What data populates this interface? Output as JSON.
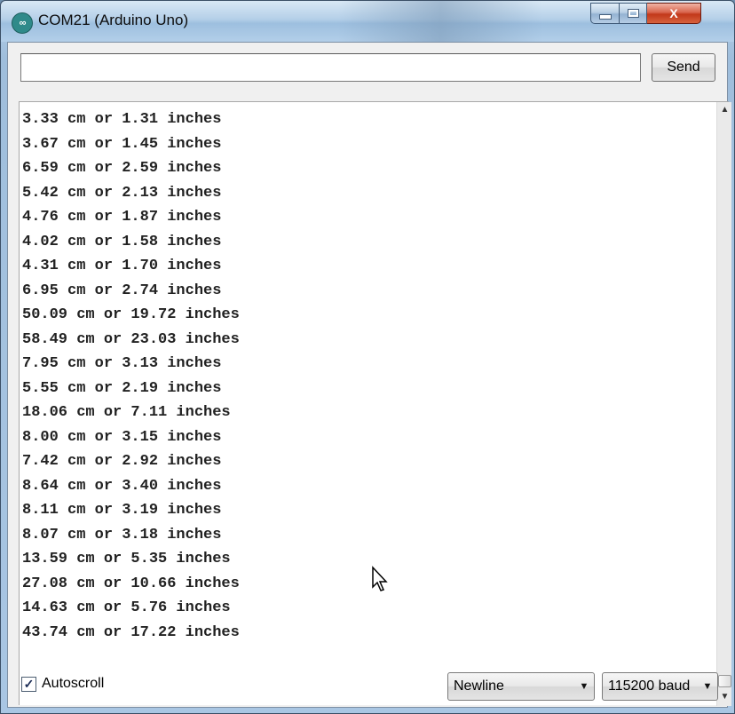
{
  "window": {
    "title": "COM21 (Arduino Uno)",
    "icon": "arduino-infinity-icon",
    "controls": [
      "minimize-icon",
      "maximize-icon",
      "close-icon"
    ],
    "close_glyph": "X",
    "app_icon_glyph": "∞"
  },
  "send": {
    "input_value": "",
    "button_label": "Send"
  },
  "serial_output": [
    "3.33 cm or 1.31 inches",
    "3.67 cm or 1.45 inches",
    "6.59 cm or 2.59 inches",
    "5.42 cm or 2.13 inches",
    "4.76 cm or 1.87 inches",
    "4.02 cm or 1.58 inches",
    "4.31 cm or 1.70 inches",
    "6.95 cm or 2.74 inches",
    "50.09 cm or 19.72 inches",
    "58.49 cm or 23.03 inches",
    "7.95 cm or 3.13 inches",
    "5.55 cm or 2.19 inches",
    "18.06 cm or 7.11 inches",
    "8.00 cm or 3.15 inches",
    "7.42 cm or 2.92 inches",
    "8.64 cm or 3.40 inches",
    "8.11 cm or 3.19 inches",
    "8.07 cm or 3.18 inches",
    "13.59 cm or 5.35 inches",
    "27.08 cm or 10.66 inches",
    "14.63 cm or 5.76 inches",
    "43.74 cm or 17.22 inches"
  ],
  "footer": {
    "autoscroll_label": "Autoscroll",
    "autoscroll_checked": true,
    "line_ending": "Newline",
    "baud_rate": "115200 baud"
  },
  "colors": {
    "titlebar": "#b4cfe8",
    "close_button": "#c2381a",
    "output_background": "#ffffff",
    "text": "#222222"
  }
}
